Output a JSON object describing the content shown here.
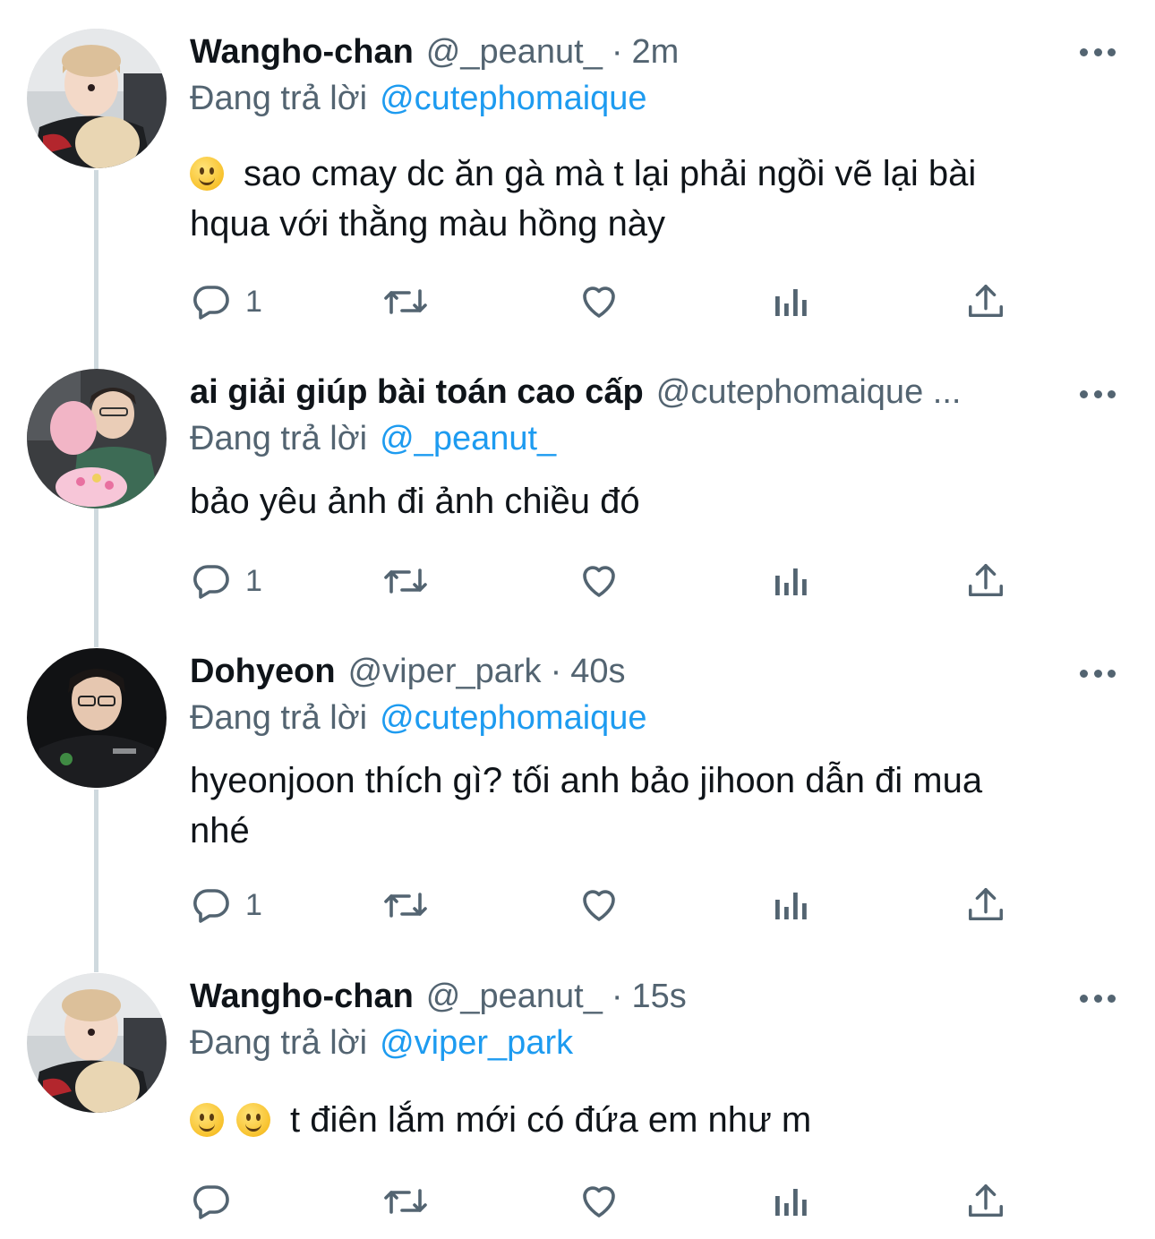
{
  "tweets": [
    {
      "name": "Wangho-chan",
      "handle": "@_peanut_",
      "separator": "·",
      "time": "2m",
      "replying_label": "Đang trả lời",
      "replying_to": "@cutephomaique",
      "emoji_count": 1,
      "text_line1": "sao cmay dc ăn gà mà t lại phải ngồi vẽ lại bài",
      "text_line2": "hqua với thằng màu hồng này",
      "reply_count": "1"
    },
    {
      "name": "ai giải giúp bài toán cao cấp",
      "handle": "@cutephomaique ...",
      "replying_label": "Đang trả lời",
      "replying_to": "@_peanut_",
      "text_line1": "bảo yêu ảnh đi ảnh chiều đó",
      "reply_count": "1"
    },
    {
      "name": "Dohyeon",
      "handle": "@viper_park",
      "separator": "·",
      "time": "40s",
      "replying_label": "Đang trả lời",
      "replying_to": "@cutephomaique",
      "text_line1": "hyeonjoon thích gì? tối anh bảo jihoon dẫn đi mua",
      "text_line2": "nhé",
      "reply_count": "1"
    },
    {
      "name": "Wangho-chan",
      "handle": "@_peanut_",
      "separator": "·",
      "time": "15s",
      "replying_label": "Đang trả lời",
      "replying_to": "@viper_park",
      "emoji_count": 2,
      "text_line1": "t điên lắm mới có đứa em như m",
      "reply_count": ""
    }
  ],
  "icons": {
    "reply": "speech-bubble-icon",
    "retweet": "retweet-arrows-icon",
    "like": "heart-outline-icon",
    "analytics": "bar-chart-icon",
    "share": "share-upload-icon",
    "more": "three-dots-icon",
    "emoji": "slightly-smiling-face-emoji"
  },
  "colors": {
    "text": "#0f1419",
    "secondary": "#536471",
    "mention": "#1d9bf0",
    "thread_line": "#cfd9de"
  }
}
